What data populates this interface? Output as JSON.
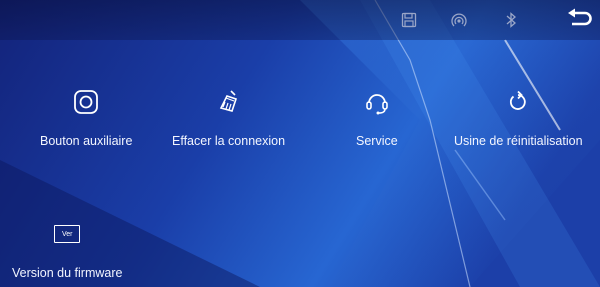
{
  "status_bar": {
    "icons": [
      "save-icon",
      "hotspot-icon",
      "bluetooth-icon"
    ],
    "back_icon": "back-arrow-icon"
  },
  "menu": {
    "items": [
      {
        "label": "Bouton auxiliaire",
        "icon": "auxiliary-button-icon"
      },
      {
        "label": "Effacer la connexion",
        "icon": "broom-icon"
      },
      {
        "label": "Service",
        "icon": "headset-icon"
      },
      {
        "label": "Usine de réinitialisation",
        "icon": "reset-icon"
      },
      {
        "label": "Version du firmware",
        "icon": "version-icon",
        "icon_text": "Ver"
      }
    ]
  },
  "colors": {
    "background_dark": "#101f73",
    "background_light": "#2f6fe0",
    "text": "#ffffff"
  }
}
